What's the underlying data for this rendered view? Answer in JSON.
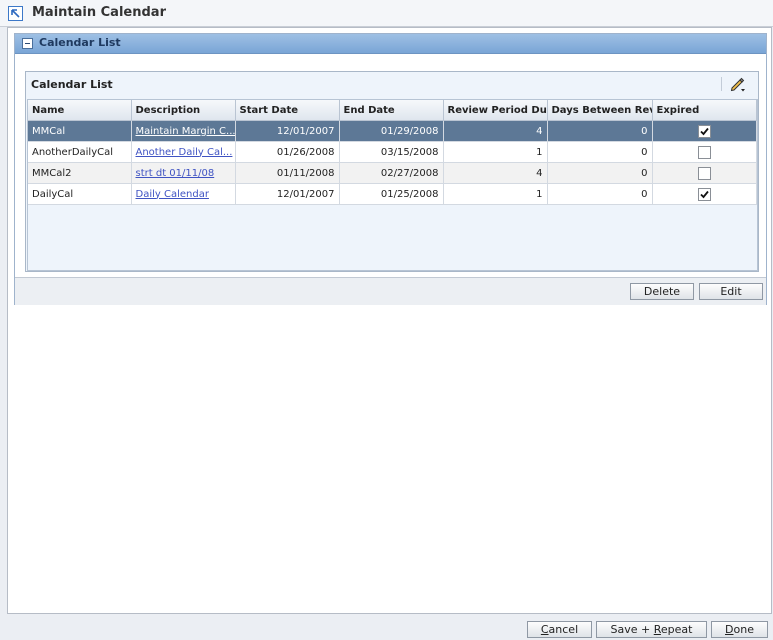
{
  "window": {
    "title": "Maintain Calendar"
  },
  "section": {
    "title": "Calendar List"
  },
  "panel": {
    "title": "Calendar List",
    "edit_icon": "pencil-icon"
  },
  "table": {
    "columns": [
      "Name",
      "Description",
      "Start Date",
      "End Date",
      "Review Period Duration",
      "Days Between Review",
      "Expired"
    ],
    "rows": [
      {
        "name": "MMCal",
        "description": "Maintain Margin C...",
        "start_date": "12/01/2007",
        "end_date": "01/29/2008",
        "review_period": "4",
        "days_between": "0",
        "expired": true
      },
      {
        "name": "AnotherDailyCal",
        "description": "Another Daily Cal...",
        "start_date": "01/26/2008",
        "end_date": "03/15/2008",
        "review_period": "1",
        "days_between": "0",
        "expired": false
      },
      {
        "name": "MMCal2",
        "description": "strt dt 01/11/08",
        "start_date": "01/11/2008",
        "end_date": "02/27/2008",
        "review_period": "4",
        "days_between": "0",
        "expired": false
      },
      {
        "name": "DailyCal",
        "description": "Daily Calendar",
        "start_date": "12/01/2007",
        "end_date": "01/25/2008",
        "review_period": "1",
        "days_between": "0",
        "expired": true
      }
    ],
    "selected_row": 0
  },
  "actions": {
    "delete": "Delete",
    "edit": "Edit"
  },
  "bottom": {
    "cancel_prefix": "",
    "cancel_hot": "C",
    "cancel_suffix": "ancel",
    "save_prefix": "Save + ",
    "save_hot": "R",
    "save_suffix": "epeat",
    "done_prefix": "",
    "done_hot": "D",
    "done_suffix": "one"
  }
}
